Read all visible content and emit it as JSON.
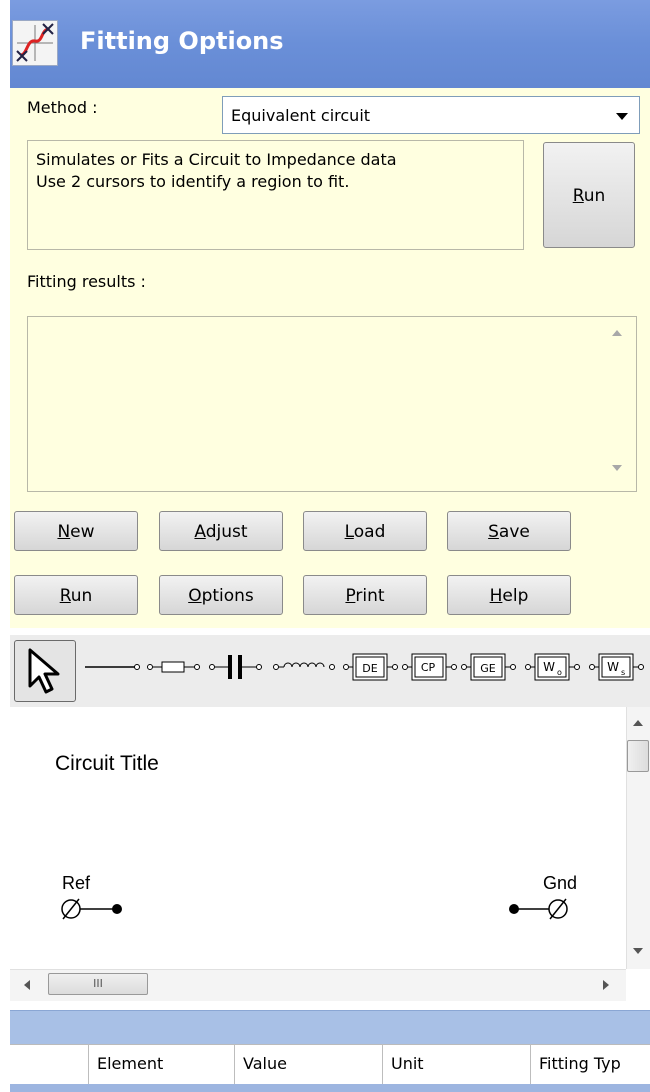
{
  "window": {
    "title": "Fitting Options"
  },
  "method": {
    "label": "Method :",
    "selected": "Equivalent circuit"
  },
  "description": {
    "line1": "Simulates or Fits a Circuit to Impedance data",
    "line2": "Use 2 cursors to identify a region to fit."
  },
  "run_top": {
    "mnemonic": "R",
    "rest": "un"
  },
  "results": {
    "label": "Fitting results :"
  },
  "buttons_row1": [
    {
      "mnemonic": "N",
      "rest": "ew"
    },
    {
      "mnemonic": "A",
      "rest": "djust"
    },
    {
      "mnemonic": "L",
      "rest": "oad"
    },
    {
      "mnemonic": "S",
      "rest": "ave"
    }
  ],
  "buttons_row2": [
    {
      "mnemonic": "R",
      "rest": "un"
    },
    {
      "mnemonic": "O",
      "rest": "ptions"
    },
    {
      "mnemonic": "P",
      "rest": "rint"
    },
    {
      "mnemonic": "H",
      "rest": "elp"
    }
  ],
  "toolbar": {
    "tools": [
      "pointer-icon",
      "wire-icon",
      "resistor-icon",
      "capacitor-icon",
      "inductor-icon",
      "de-element-icon",
      "cpe-element-icon",
      "ge-element-icon",
      "wo-element-icon",
      "ws-element-icon"
    ],
    "labels": {
      "de": "DE",
      "cp": "CP",
      "ge": "GE",
      "wo": "W",
      "wo_sub": "o",
      "ws": "W",
      "ws_sub": "s"
    }
  },
  "circuit": {
    "title": "Circuit Title",
    "ref": "Ref",
    "gnd": "Gnd"
  },
  "hscroll": {
    "grip": "III"
  },
  "grid": {
    "columns": [
      "Element",
      "Value",
      "Unit",
      "Fitting Typ"
    ]
  },
  "colors": {
    "titlebar": "#6a8fd8",
    "panel": "#ffffe0",
    "grid_header": "#a8c0e6"
  }
}
